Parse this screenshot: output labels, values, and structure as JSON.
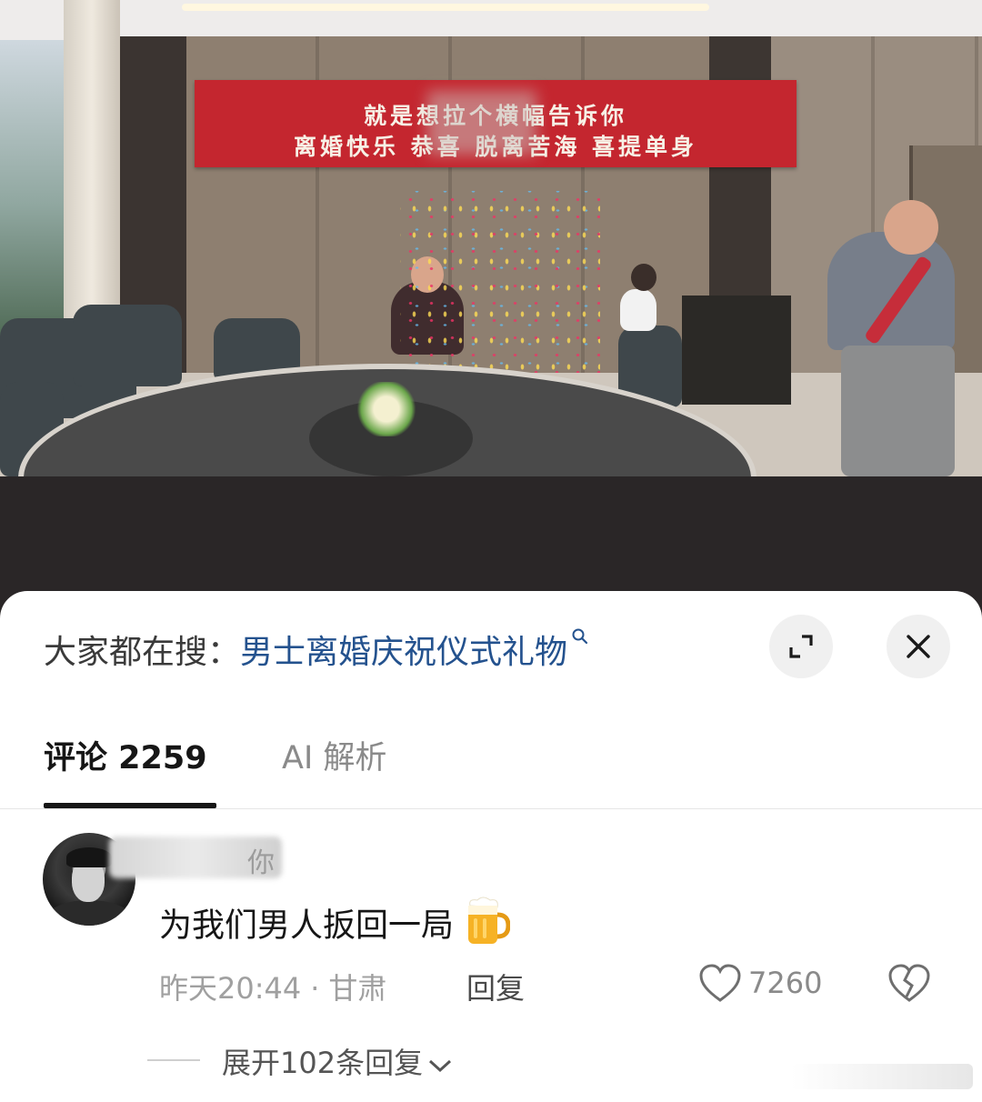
{
  "banner": {
    "line1": "就是想拉个横幅告诉你",
    "line2": "离婚快乐 恭喜 脱离苦海 喜提单身"
  },
  "search": {
    "prefix": "大家都在搜：",
    "query": "男士离婚庆祝仪式礼物"
  },
  "tabs": [
    {
      "label": "评论 2259",
      "active": true
    },
    {
      "label": "AI 解析",
      "active": false
    }
  ],
  "comment": {
    "username": "你",
    "text": "为我们男人扳回一局",
    "time": "昨天20:44",
    "location": "甘肃",
    "reply_label": "回复",
    "likes": "7260",
    "expand_label": "展开102条回复"
  },
  "colors": {
    "query": "#24528e",
    "banner": "#c4262f",
    "tab_active": "#161616",
    "muted": "#a0a0a0"
  },
  "icons": [
    "search-icon",
    "expand-icon",
    "close-icon",
    "beer-icon",
    "heart-icon",
    "broken-heart-icon",
    "chevron-down-icon"
  ]
}
